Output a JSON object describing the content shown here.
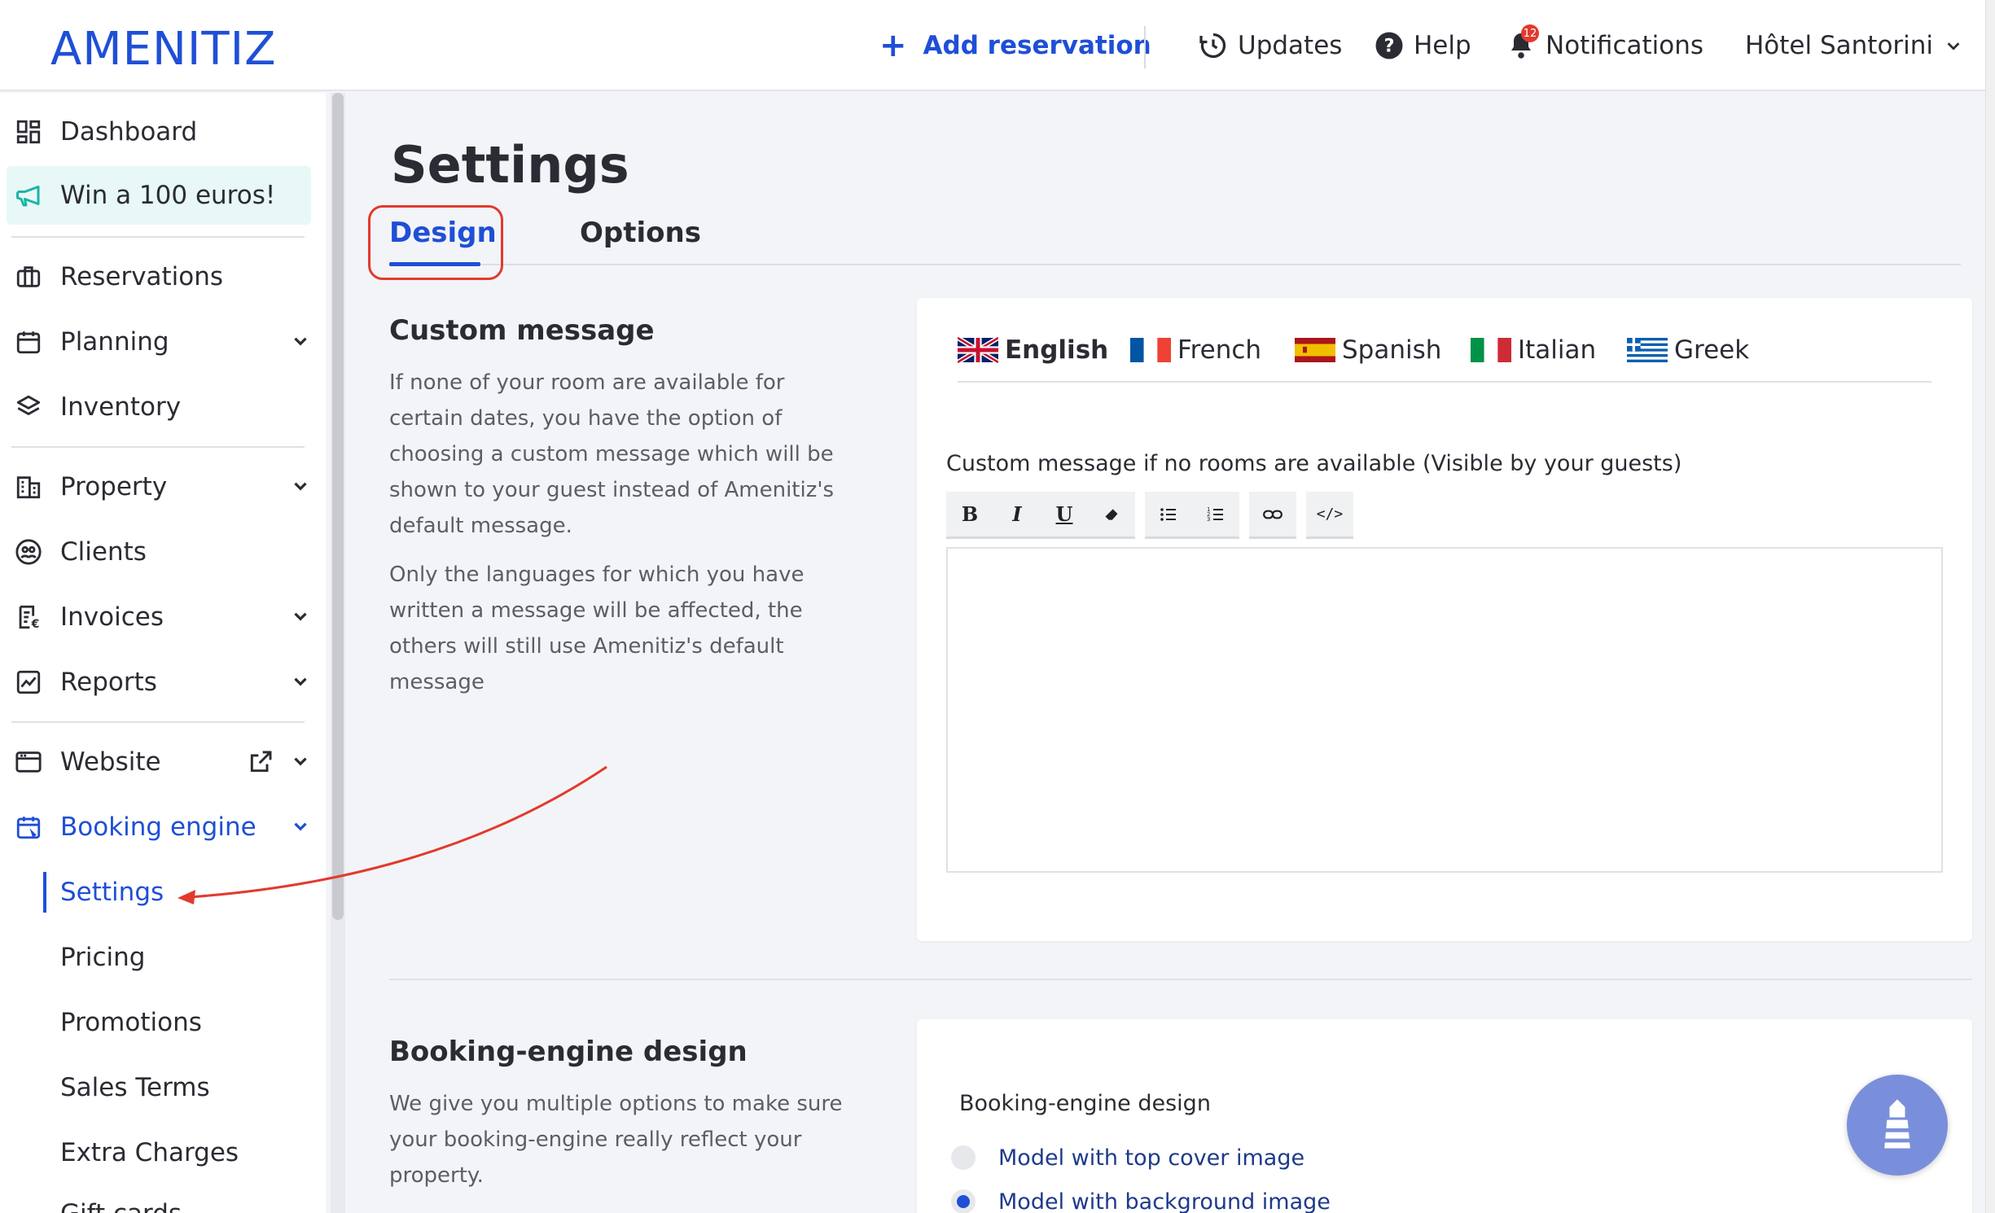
{
  "brand": {
    "logo": "AMENITIZ",
    "accent": "#1f4fd6"
  },
  "topbar": {
    "add_reservation": "Add reservation",
    "updates": "Updates",
    "help": "Help",
    "notifications": "Notifications",
    "notifications_count": "12",
    "hotel": "Hôtel Santorini"
  },
  "sidebar": {
    "items": [
      {
        "label": "Dashboard",
        "icon": "dashboard-icon"
      },
      {
        "label": "Win a 100 euros!",
        "icon": "megaphone-icon"
      },
      {
        "label": "Reservations",
        "icon": "suitcase-icon"
      },
      {
        "label": "Planning",
        "icon": "calendar-icon"
      },
      {
        "label": "Inventory",
        "icon": "layers-icon"
      },
      {
        "label": "Property",
        "icon": "building-icon"
      },
      {
        "label": "Clients",
        "icon": "clients-icon"
      },
      {
        "label": "Invoices",
        "icon": "invoice-icon"
      },
      {
        "label": "Reports",
        "icon": "chart-icon"
      },
      {
        "label": "Website",
        "icon": "browser-icon"
      },
      {
        "label": "Booking engine",
        "icon": "booking-calendar-icon"
      }
    ],
    "booking_sub": [
      "Settings",
      "Pricing",
      "Promotions",
      "Sales Terms",
      "Extra Charges",
      "Gift cards"
    ]
  },
  "page": {
    "title": "Settings",
    "tabs": [
      {
        "label": "Design",
        "active": true
      },
      {
        "label": "Options",
        "active": false
      }
    ]
  },
  "custom_message": {
    "title": "Custom message",
    "para1": "If none of your room are available for certain dates, you have the option of choosing a custom message which will be shown to your guest instead of Amenitiz's default message.",
    "para2": "Only the languages for which you have written a message will be affected, the others will still use Amenitiz's default message",
    "languages": [
      "English",
      "French",
      "Spanish",
      "Italian",
      "Greek"
    ],
    "field_label": "Custom message if no rooms are available (Visible by your guests)",
    "editor_value": ""
  },
  "booking_design": {
    "title": "Booking-engine design",
    "para": "We give you multiple options to make sure your booking-engine really reflect your property.",
    "label": "Booking-engine design",
    "options": [
      {
        "label": "Model with top cover image",
        "selected": false
      },
      {
        "label": "Model with background image",
        "selected": true
      }
    ]
  }
}
